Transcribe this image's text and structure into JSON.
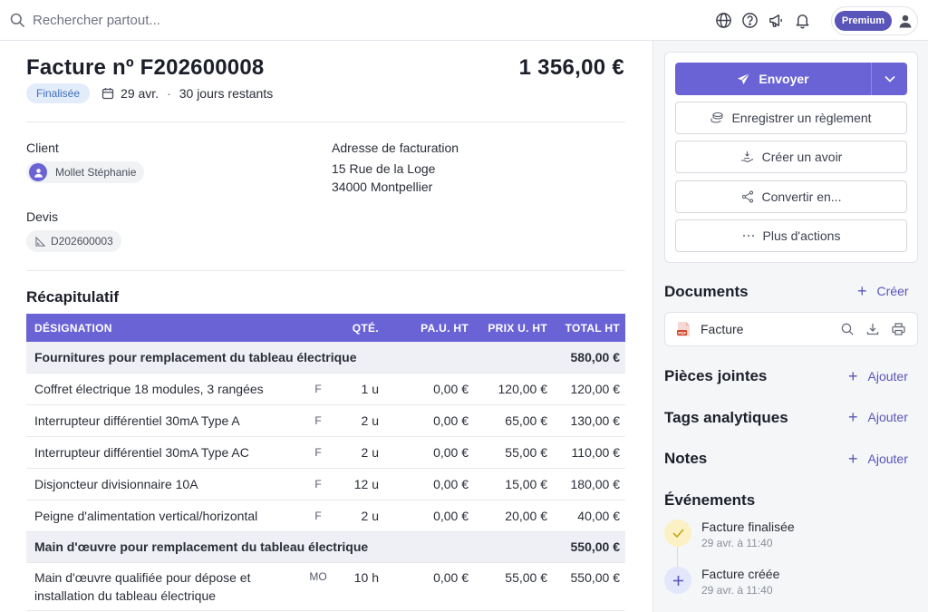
{
  "search": {
    "placeholder": "Rechercher partout..."
  },
  "topbar": {
    "premium_label": "Premium",
    "icons": [
      "globe-icon",
      "help-icon",
      "megaphone-icon",
      "bell-icon",
      "user-icon"
    ]
  },
  "invoice": {
    "title": "Facture nº F202600008",
    "amount": "1 356,00 €",
    "status": "Finalisée",
    "date": "29 avr.",
    "separator": "·",
    "remaining": "30 jours restants",
    "client_label": "Client",
    "client_name": "Mollet Stéphanie",
    "billing_label": "Adresse de facturation",
    "address_line1": "15 Rue de la Loge",
    "address_line2": "34000 Montpellier",
    "quote_label": "Devis",
    "quote_ref": "D202600003"
  },
  "recap": {
    "title": "Récapitulatif",
    "headers": {
      "designation": "DÉSIGNATION",
      "qty": "QTÉ.",
      "pau": "PA.U. HT",
      "pu": "PRIX U. HT",
      "total": "TOTAL HT"
    },
    "groups": [
      {
        "title": "Fournitures pour remplacement du tableau électrique",
        "total": "580,00 €",
        "rows": [
          {
            "label": "Coffret électrique 18 modules, 3 rangées",
            "type": "F",
            "qty": "1 u",
            "pau": "0,00 €",
            "pu": "120,00 €",
            "total": "120,00 €"
          },
          {
            "label": "Interrupteur différentiel 30mA Type A",
            "type": "F",
            "qty": "2 u",
            "pau": "0,00 €",
            "pu": "65,00 €",
            "total": "130,00 €"
          },
          {
            "label": "Interrupteur différentiel 30mA Type AC",
            "type": "F",
            "qty": "2 u",
            "pau": "0,00 €",
            "pu": "55,00 €",
            "total": "110,00 €"
          },
          {
            "label": "Disjoncteur divisionnaire 10A",
            "type": "F",
            "qty": "12 u",
            "pau": "0,00 €",
            "pu": "15,00 €",
            "total": "180,00 €"
          },
          {
            "label": "Peigne d'alimentation vertical/horizontal",
            "type": "F",
            "qty": "2 u",
            "pau": "0,00 €",
            "pu": "20,00 €",
            "total": "40,00 €"
          }
        ]
      },
      {
        "title": "Main d'œuvre pour remplacement du tableau électrique",
        "total": "550,00 €",
        "rows": [
          {
            "label": "Main d'œuvre qualifiée pour dépose et",
            "label2": "installation du tableau électrique",
            "type": "MO",
            "qty": "10 h",
            "pau": "0,00 €",
            "pu": "55,00 €",
            "total": "550,00 €"
          }
        ]
      }
    ]
  },
  "actions": {
    "send": "Envoyer",
    "payment": "Enregistrer un règlement",
    "credit": "Créer un avoir",
    "convert": "Convertir en...",
    "more": "Plus d'actions"
  },
  "documents": {
    "title": "Documents",
    "create": "Créer",
    "file": "Facture"
  },
  "attachments": {
    "title": "Pièces jointes",
    "add": "Ajouter"
  },
  "tags": {
    "title": "Tags analytiques",
    "add": "Ajouter"
  },
  "notes": {
    "title": "Notes",
    "add": "Ajouter"
  },
  "events": {
    "title": "Événements",
    "items": [
      {
        "label": "Facture finalisée",
        "date": "29 avr. à 11:40",
        "color": "#fbf1c4"
      },
      {
        "label": "Facture créée",
        "date": "29 avr. à 11:40",
        "color": "#e2e7fb"
      }
    ]
  },
  "colors": {
    "accent": "#6a63d6",
    "badge_bg": "#e3ecfb",
    "badge_text": "#3f6fb8"
  }
}
